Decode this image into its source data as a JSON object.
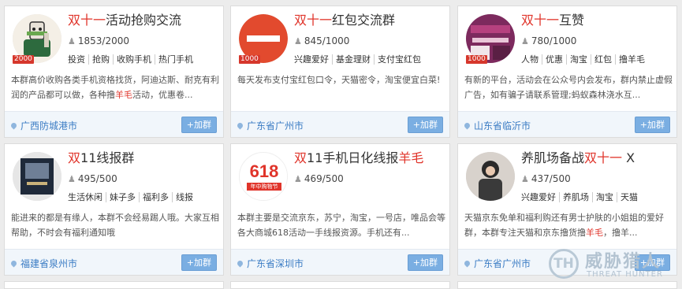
{
  "cards": [
    {
      "title_hl": "双十一",
      "title_rest": "活动抢购交流",
      "members": "1853/2000",
      "tags": [
        "投资",
        "抢购",
        "收购手机",
        "热门手机"
      ],
      "desc": "本群高价收购各类手机资格找货，阿迪达斯、耐克有利润的产品都可以做，各种撸",
      "desc_hl": "羊毛",
      "desc_rest": "活动，优惠卷...",
      "location": "广西防城港市",
      "join": "+加群",
      "level": "2000"
    },
    {
      "title_hl": "双十一",
      "title_rest": "红包交流群",
      "members": "845/1000",
      "tags": [
        "兴趣爱好",
        "基金理财",
        "支付宝红包"
      ],
      "desc": "每天发布支付宝红包口令，天猫密令，淘宝便宜白菜!",
      "location": "广东省广州市",
      "join": "+加群",
      "level": "1000"
    },
    {
      "title_hl": "双十一",
      "title_rest": "互赞",
      "members": "780/1000",
      "tags": [
        "人物",
        "优惠",
        "淘宝",
        "红包",
        "撸羊毛"
      ],
      "desc": "有新的平台，活动会在公众号内会发布，群内禁止虚假广告，如有骗子请联系管理;蚂蚁森林浇水互...",
      "location": "山东省临沂市",
      "join": "+加群",
      "level": "1000"
    },
    {
      "title_hl": "双",
      "title_rest": "11线报群",
      "members": "495/500",
      "tags": [
        "生活休闲",
        "妹子多",
        "福利多",
        "线报"
      ],
      "desc": "能进来的都是有缘人，本群不会经易踢人哦。大家互相帮助，不时会有福利通知哦",
      "location": "福建省泉州市",
      "join": "+加群"
    },
    {
      "title_hl": "双",
      "title_rest": "11手机日化线报",
      "title_hl2": "羊毛",
      "members": "469/500",
      "tags": [],
      "desc": "本群主要是交流京东，苏宁，淘宝，一号店，唯品会等各大商城618活动一手线报资源。手机还有...",
      "location": "广东省深圳市",
      "join": "+加群",
      "logo_text": "618",
      "logo_sub": "年中购物节"
    },
    {
      "title_pre": "养肌场备战",
      "title_hl": "双十一",
      "title_rest": " X",
      "members": "437/500",
      "tags": [
        "兴趣爱好",
        "养肌场",
        "淘宝",
        "天猫"
      ],
      "desc": "天猫京东免单和福利购还有男士护肤的小姐姐的爱好群，本群专注天猫和京东撸货撸",
      "desc_hl": "羊毛",
      "desc_rest": "，撸羊...",
      "location": "广东省广州市",
      "join": "+加群"
    }
  ],
  "watermark": {
    "logo": "TH",
    "cn": "威胁猎人",
    "en": "THREAT HUNTER"
  },
  "colors": {
    "highlight": "#e0342a",
    "location": "#3b7cc4",
    "join_button": "#7aaee2"
  }
}
